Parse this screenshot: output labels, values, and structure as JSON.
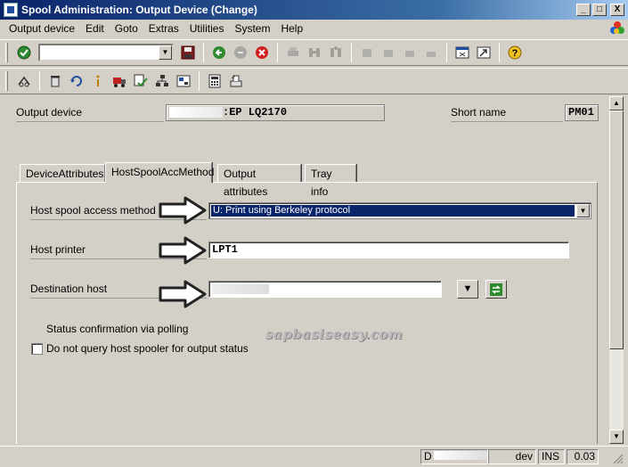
{
  "window": {
    "title": "Spool Administration: Output Device (Change)",
    "buttons": {
      "minimize": "_",
      "maximize": "□",
      "close": "X"
    }
  },
  "menu": [
    "Output device",
    "Edit",
    "Goto",
    "Extras",
    "Utilities",
    "System",
    "Help"
  ],
  "toolbar1": {
    "icons": [
      "enter-check-icon",
      "command-field",
      "save-icon",
      "back-icon",
      "exit-icon",
      "cancel-icon",
      "print-icon",
      "find-icon",
      "find-next-icon",
      "first-page-icon",
      "previous-page-icon",
      "next-page-icon",
      "last-page-icon",
      "create-session-icon",
      "shortcut-icon",
      "help-icon"
    ]
  },
  "toolbar2": {
    "icons": [
      "display-change-icon",
      "delete-icon",
      "undo-icon",
      "info-icon",
      "transport-icon",
      "check-icon",
      "hierarchy-icon",
      "classification-icon",
      "calculator-icon",
      "print-preview-icon"
    ]
  },
  "header": {
    "output_device_label": "Output device",
    "output_device_value": "EP LQ2170",
    "short_name_label": "Short name",
    "short_name_value": "PM01"
  },
  "tabs": [
    {
      "label": "DeviceAttributes",
      "active": false
    },
    {
      "label": "HostSpoolAccMethod",
      "active": true
    },
    {
      "label": "Output attributes",
      "active": false
    },
    {
      "label": "Tray info",
      "active": false
    }
  ],
  "form": {
    "access_method_label": "Host spool access method",
    "access_method_value": "U: Print using Berkeley protocol",
    "host_printer_label": "Host printer",
    "host_printer_value": "LPT1",
    "destination_host_label": "Destination host",
    "status_heading": "Status confirmation via polling",
    "no_query_label": "Do not query host spooler for output status",
    "no_query_checked": false
  },
  "watermark": "sapbasiseasy.com",
  "statusbar": {
    "system": "D",
    "client": "dev",
    "mode": "INS",
    "time": "0.03"
  },
  "colors": {
    "title_gradient_start": "#0a246a",
    "selection_blue": "#0a246a",
    "window_bg": "#d4d0c8"
  }
}
